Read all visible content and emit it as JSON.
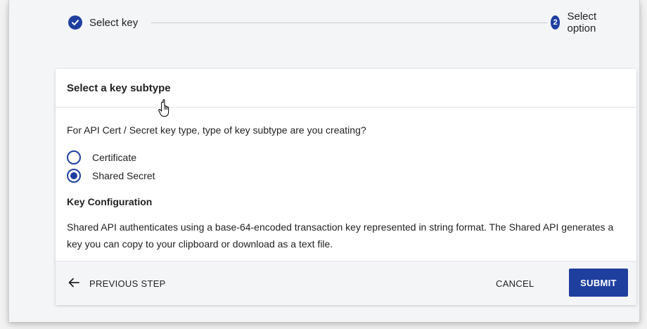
{
  "stepper": {
    "steps": [
      {
        "label": "Select key",
        "state": "complete",
        "icon": "check-icon"
      },
      {
        "number": "2",
        "label": "Select option",
        "state": "active"
      }
    ]
  },
  "card": {
    "title": "Select a key subtype",
    "question": "For API Cert / Secret key type, type of key subtype are you creating?",
    "options": [
      {
        "label": "Certificate",
        "selected": false
      },
      {
        "label": "Shared Secret",
        "selected": true
      }
    ],
    "config_title": "Key Configuration",
    "config_text": "Shared API authenticates using a base-64-encoded transaction key represented in string format. The Shared API generates a key you can copy to your clipboard or download as a text file."
  },
  "footer": {
    "previous_label": "PREVIOUS STEP",
    "cancel_label": "CANCEL",
    "submit_label": "SUBMIT"
  },
  "colors": {
    "accent": "#1f3f9f",
    "footer_bg": "#f4f5f7"
  }
}
